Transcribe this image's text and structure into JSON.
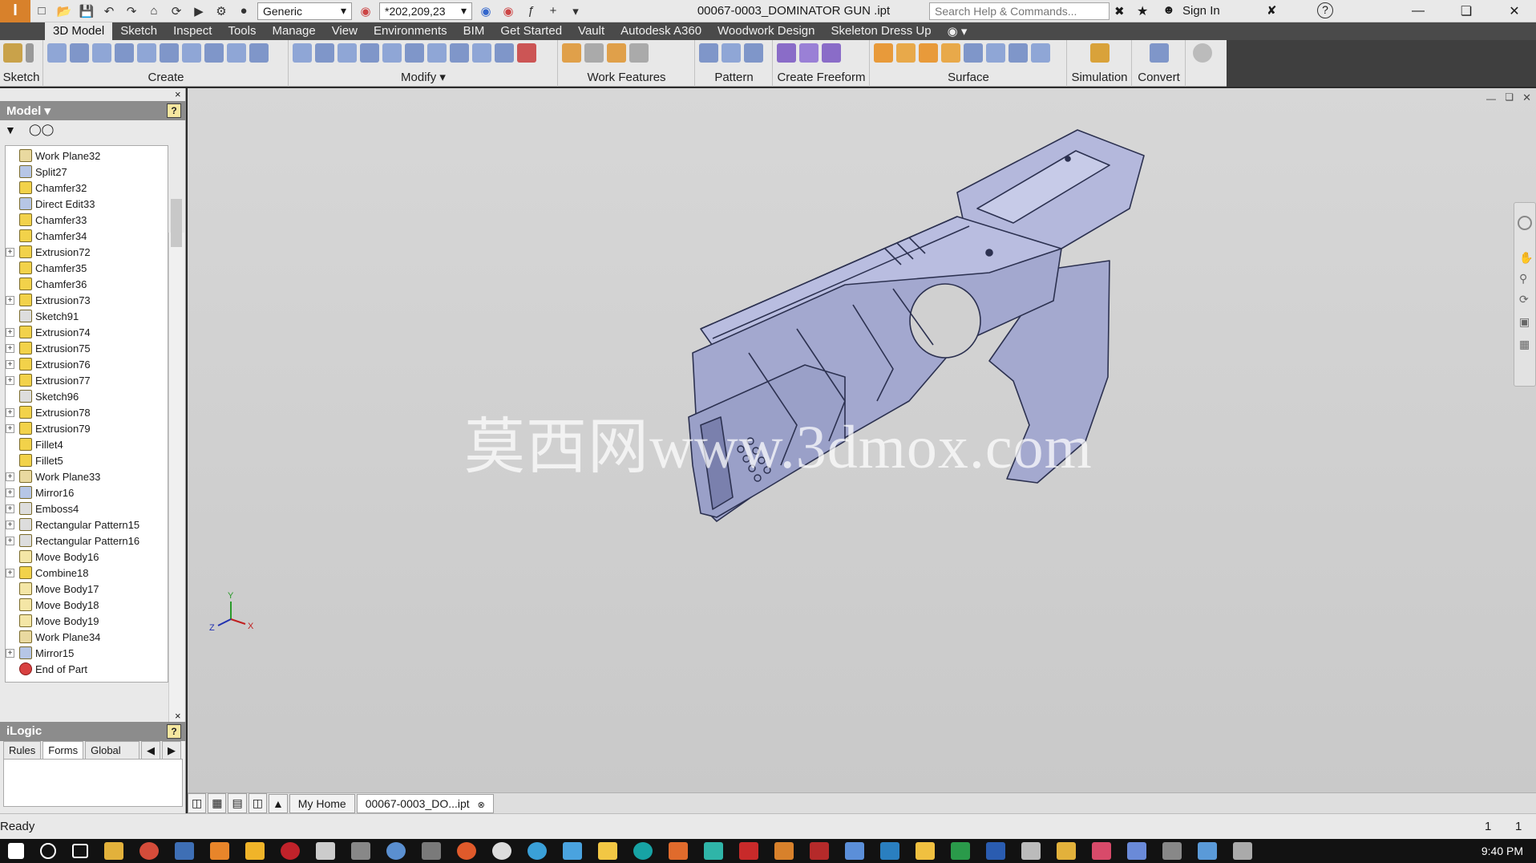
{
  "titlebar": {
    "app_logo": "I",
    "appearance_dropdown": "Generic",
    "color_dropdown": "*202,209,23",
    "document_title": "00067-0003_DOMINATOR GUN .ipt",
    "search_placeholder": "Search Help & Commands...",
    "sign_in": "Sign In",
    "help_icon": "?"
  },
  "ribbon_tabs": [
    "3D Model",
    "Sketch",
    "Inspect",
    "Tools",
    "Manage",
    "View",
    "Environments",
    "BIM",
    "Get Started",
    "Vault",
    "Autodesk A360",
    "Woodwork Design",
    "Skeleton Dress Up"
  ],
  "active_tab": "3D Model",
  "ribbon_panels": [
    {
      "label": "Sketch"
    },
    {
      "label": "Create"
    },
    {
      "label": "Modify ▾"
    },
    {
      "label": "Work Features"
    },
    {
      "label": "Pattern"
    },
    {
      "label": "Create Freeform"
    },
    {
      "label": "Surface"
    },
    {
      "label": "Simulation"
    },
    {
      "label": "Convert"
    }
  ],
  "browser": {
    "title": "Model ▾",
    "help": "?",
    "close": "×",
    "items": [
      {
        "label": "Work Plane32",
        "expand": false,
        "icon": "work-plane"
      },
      {
        "label": "Split27",
        "expand": false,
        "icon": "split"
      },
      {
        "label": "Chamfer32",
        "expand": false,
        "icon": "chamfer"
      },
      {
        "label": "Direct Edit33",
        "expand": false,
        "icon": "direct-edit"
      },
      {
        "label": "Chamfer33",
        "expand": false,
        "icon": "chamfer"
      },
      {
        "label": "Chamfer34",
        "expand": false,
        "icon": "chamfer"
      },
      {
        "label": "Extrusion72",
        "expand": true,
        "icon": "extrusion"
      },
      {
        "label": "Chamfer35",
        "expand": false,
        "icon": "chamfer"
      },
      {
        "label": "Chamfer36",
        "expand": false,
        "icon": "chamfer"
      },
      {
        "label": "Extrusion73",
        "expand": true,
        "icon": "extrusion"
      },
      {
        "label": "Sketch91",
        "expand": false,
        "icon": "sketch"
      },
      {
        "label": "Extrusion74",
        "expand": true,
        "icon": "extrusion"
      },
      {
        "label": "Extrusion75",
        "expand": true,
        "icon": "extrusion"
      },
      {
        "label": "Extrusion76",
        "expand": true,
        "icon": "extrusion"
      },
      {
        "label": "Extrusion77",
        "expand": true,
        "icon": "extrusion"
      },
      {
        "label": "Sketch96",
        "expand": false,
        "icon": "sketch"
      },
      {
        "label": "Extrusion78",
        "expand": true,
        "icon": "extrusion"
      },
      {
        "label": "Extrusion79",
        "expand": true,
        "icon": "extrusion"
      },
      {
        "label": "Fillet4",
        "expand": false,
        "icon": "fillet"
      },
      {
        "label": "Fillet5",
        "expand": false,
        "icon": "fillet"
      },
      {
        "label": "Work Plane33",
        "expand": true,
        "icon": "work-plane"
      },
      {
        "label": "Mirror16",
        "expand": true,
        "icon": "mirror"
      },
      {
        "label": "Emboss4",
        "expand": true,
        "icon": "emboss"
      },
      {
        "label": "Rectangular Pattern15",
        "expand": true,
        "icon": "pattern"
      },
      {
        "label": "Rectangular Pattern16",
        "expand": true,
        "icon": "pattern"
      },
      {
        "label": "Move Body16",
        "expand": false,
        "icon": "move-body"
      },
      {
        "label": "Combine18",
        "expand": true,
        "icon": "combine"
      },
      {
        "label": "Move Body17",
        "expand": false,
        "icon": "move-body"
      },
      {
        "label": "Move Body18",
        "expand": false,
        "icon": "move-body"
      },
      {
        "label": "Move Body19",
        "expand": false,
        "icon": "move-body"
      },
      {
        "label": "Work Plane34",
        "expand": false,
        "icon": "work-plane"
      },
      {
        "label": "Mirror15",
        "expand": true,
        "icon": "mirror"
      },
      {
        "label": "End of Part",
        "expand": false,
        "icon": "end-of-part"
      }
    ]
  },
  "ilogic": {
    "title": "iLogic",
    "help": "?",
    "close": "×",
    "tabs": [
      "Rules",
      "Forms",
      "Global Forms"
    ],
    "active_tab": "Forms"
  },
  "viewport": {
    "watermark": "莫西网www.3dmox.com",
    "triad": {
      "x": "X",
      "y": "Y",
      "z": "Z"
    }
  },
  "doc_tabs": {
    "home": "My Home",
    "document": "00067-0003_DO...ipt"
  },
  "status": {
    "text": "Ready",
    "count1": "1",
    "count2": "1"
  },
  "taskbar": {
    "clock": "9:40 PM"
  },
  "colors": {
    "model_body": "#a9aed4",
    "model_edge": "#2c3150",
    "ribbon_bg": "#e8e8e8",
    "tab_row": "#4a4a4a",
    "accent": "#d8812b"
  }
}
